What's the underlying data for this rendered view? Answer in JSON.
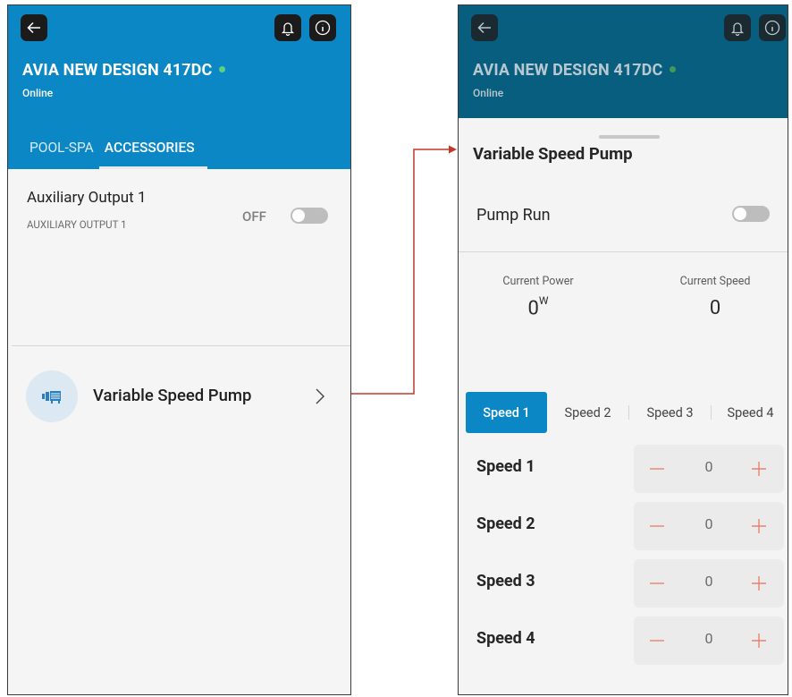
{
  "device": {
    "name": "AVIA NEW DESIGN 417DC",
    "status": "Online"
  },
  "left_screen": {
    "tabs": [
      "POOL-SPA",
      "ACCESSORIES"
    ],
    "active_tab": "ACCESSORIES",
    "aux_output": {
      "name": "Auxiliary Output 1",
      "subtitle": "AUXILIARY OUTPUT 1",
      "state_label": "OFF",
      "enabled": false
    },
    "pump_item": {
      "label": "Variable Speed Pump",
      "icon": "pump-icon"
    }
  },
  "right_screen": {
    "title": "Variable Speed Pump",
    "pump_run_label": "Pump Run",
    "pump_run_enabled": false,
    "current_power": {
      "label": "Current Power",
      "value": "0",
      "unit": "W"
    },
    "current_speed": {
      "label": "Current Speed",
      "value": "0"
    },
    "speed_tabs": [
      "Speed 1",
      "Speed 2",
      "Speed 3",
      "Speed 4"
    ],
    "active_speed_tab": "Speed 1",
    "speeds": [
      {
        "label": "Speed 1",
        "value": "0"
      },
      {
        "label": "Speed 2",
        "value": "0"
      },
      {
        "label": "Speed 3",
        "value": "0"
      },
      {
        "label": "Speed 4",
        "value": "0"
      }
    ]
  },
  "icons": {
    "back": "back-arrow-icon",
    "bell": "bell-icon",
    "info": "info-icon",
    "chevron": "chevron-right-icon",
    "minus": "minus-icon",
    "plus": "plus-icon"
  },
  "colors": {
    "header_primary": "#0b87c6",
    "header_dimmed": "#075e7e",
    "online": "#62cf7c",
    "stepper_accent": "#e9826c",
    "connector": "#c0392b"
  }
}
